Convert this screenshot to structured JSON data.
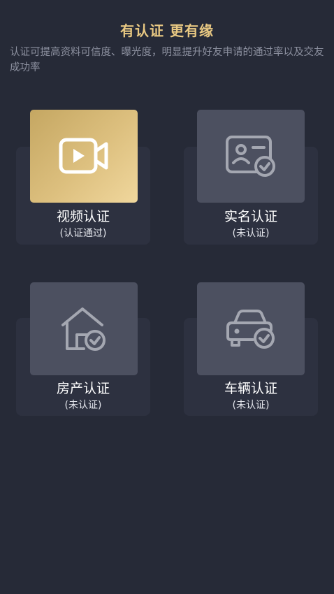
{
  "header": {
    "title": "有认证 更有缘",
    "subtitle": "认证可提高资料可信度、曝光度，明显提升好友申请的通过率以及交友成功率"
  },
  "cards": [
    {
      "label": "视频认证",
      "status": "(认证通过)",
      "icon": "video-camera-icon"
    },
    {
      "label": "实名认证",
      "status": "(未认证)",
      "icon": "id-card-check-icon"
    },
    {
      "label": "房产认证",
      "status": "(未认证)",
      "icon": "house-check-icon"
    },
    {
      "label": "车辆认证",
      "status": "(未认证)",
      "icon": "car-check-icon"
    }
  ],
  "colors": {
    "background": "#262a37",
    "title": "#e9c983",
    "subtitle": "#8d91a0",
    "tile_inactive": "#4c5060",
    "tile_active_gradient": [
      "#c5a762",
      "#f0d79d"
    ]
  }
}
